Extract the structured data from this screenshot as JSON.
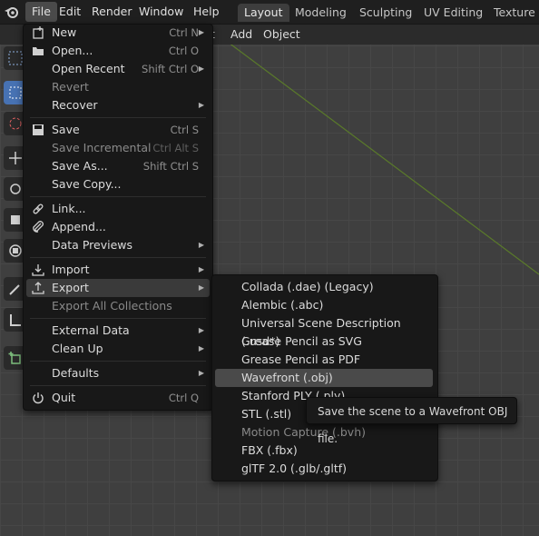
{
  "topbar": {
    "menus": [
      "File",
      "Edit",
      "Render",
      "Window",
      "Help"
    ],
    "workspace_tabs": [
      "Layout",
      "Modeling",
      "Sculpting",
      "UV Editing",
      "Texture P"
    ]
  },
  "viewport_header": {
    "menus": [
      "t",
      "Add",
      "Object"
    ]
  },
  "file_menu": {
    "items": [
      {
        "label": "New",
        "shortcut": "Ctrl N",
        "submenu": true
      },
      {
        "label": "Open...",
        "shortcut": "Ctrl O"
      },
      {
        "label": "Open Recent",
        "shortcut": "Shift Ctrl O",
        "submenu": true
      },
      {
        "label": "Revert",
        "disabled": true
      },
      {
        "label": "Recover",
        "submenu": true
      },
      {
        "label": "Save",
        "shortcut": "Ctrl S"
      },
      {
        "label": "Save Incremental",
        "shortcut": "Ctrl Alt S",
        "disabled": true
      },
      {
        "label": "Save As...",
        "shortcut": "Shift Ctrl S"
      },
      {
        "label": "Save Copy..."
      },
      {
        "label": "Link..."
      },
      {
        "label": "Append..."
      },
      {
        "label": "Data Previews",
        "submenu": true
      },
      {
        "label": "Import",
        "submenu": true
      },
      {
        "label": "Export",
        "submenu": true,
        "highlighted": true
      },
      {
        "label": "Export All Collections",
        "disabled": true
      },
      {
        "label": "External Data",
        "submenu": true
      },
      {
        "label": "Clean Up",
        "submenu": true
      },
      {
        "label": "Defaults",
        "submenu": true
      },
      {
        "label": "Quit",
        "shortcut": "Ctrl Q"
      }
    ]
  },
  "export_menu": {
    "items": [
      {
        "label": "Collada (.dae) (Legacy)"
      },
      {
        "label": "Alembic (.abc)"
      },
      {
        "label": "Universal Scene Description (.usd*)"
      },
      {
        "label": "Grease Pencil as SVG"
      },
      {
        "label": "Grease Pencil as PDF"
      },
      {
        "label": "Wavefront (.obj)",
        "highlighted": true
      },
      {
        "label": "Stanford PLY (.ply)"
      },
      {
        "label": "STL (.stl)"
      },
      {
        "label": "Motion Capture (.bvh)",
        "disabled": true
      },
      {
        "label": "FBX (.fbx)"
      },
      {
        "label": "glTF 2.0 (.glb/.gltf)"
      }
    ]
  },
  "tooltip": {
    "text": "Save the scene to a Wavefront OBJ file."
  },
  "colors": {
    "selection": "#4772b3",
    "axis_green": "#5a7a2a"
  }
}
